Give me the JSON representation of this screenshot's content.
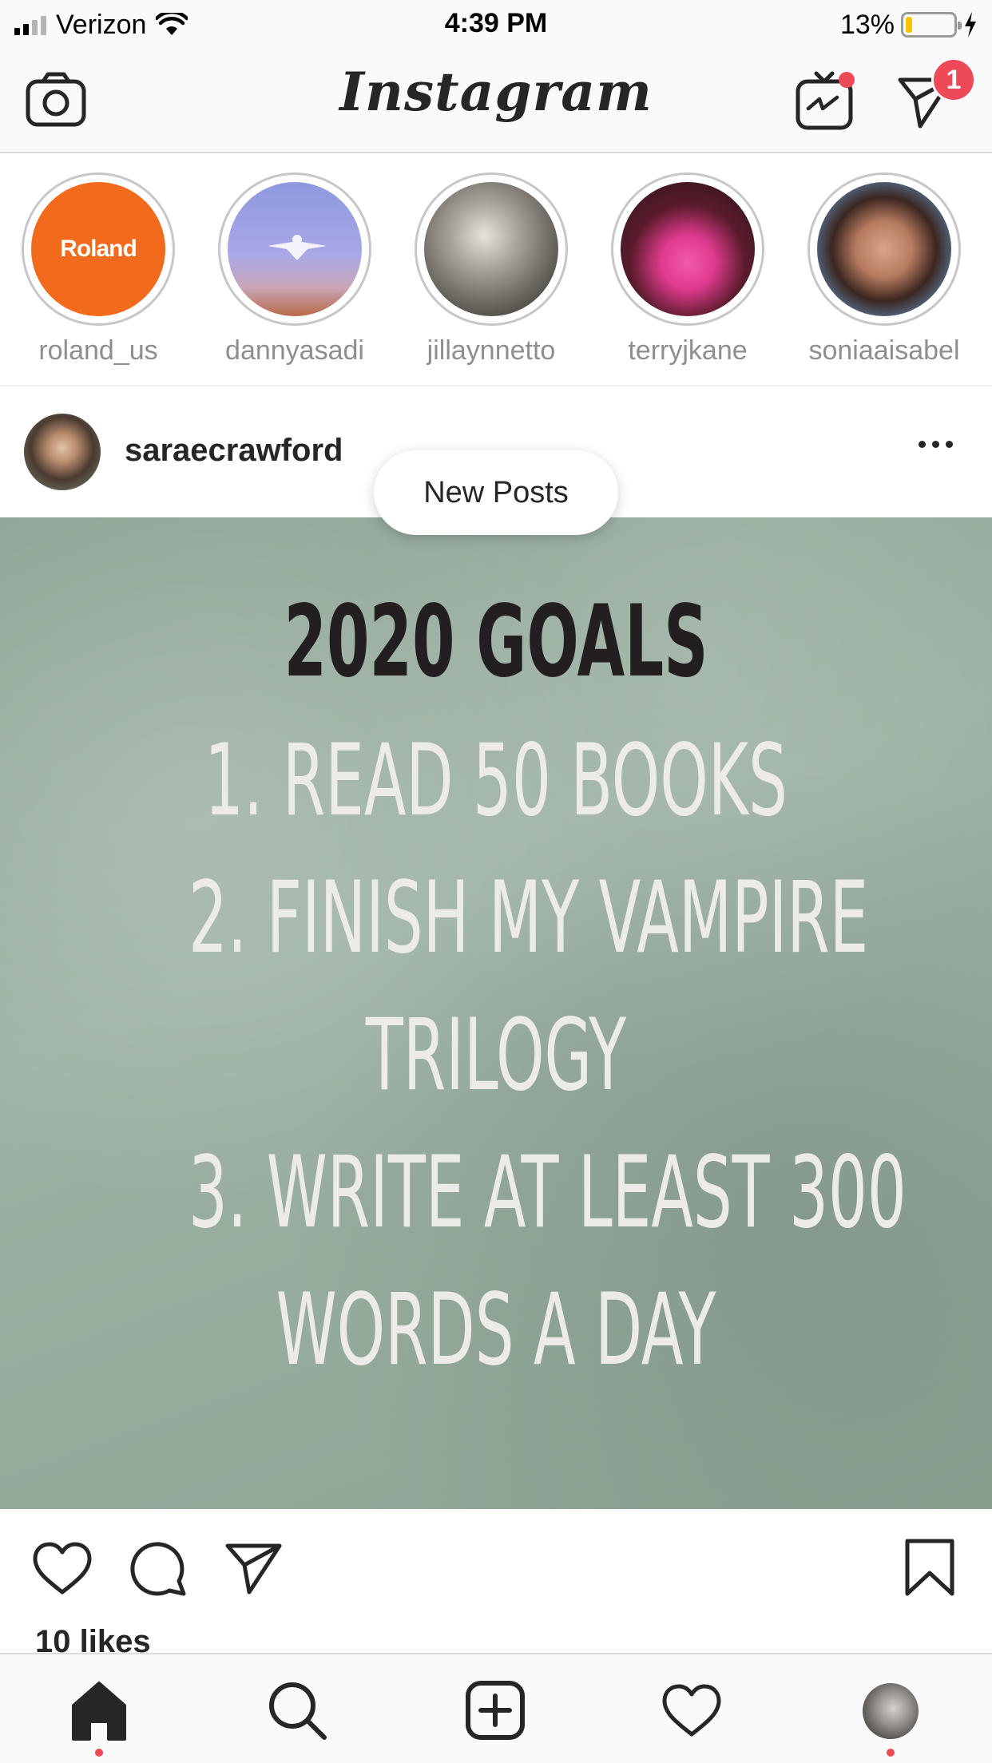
{
  "status_bar": {
    "carrier": "Verizon",
    "time": "4:39 PM",
    "battery_percent": "13%",
    "battery_level": 0.13,
    "battery_color": "#f7c600"
  },
  "header": {
    "logo": "Instagram",
    "igtv_icon": "igtv-icon",
    "igtv_has_new": true,
    "direct_icon": "paper-plane-icon",
    "direct_badge": "1",
    "badge_color": "#ed4956"
  },
  "stories": [
    {
      "username": "roland_us",
      "avatar_text": "Roland"
    },
    {
      "username": "dannyasadi"
    },
    {
      "username": "jillaynnetto"
    },
    {
      "username": "terryjkane"
    },
    {
      "username": "soniaaisabel"
    }
  ],
  "post": {
    "username": "saraecrawford",
    "new_posts_label": "New Posts",
    "image_text": {
      "title": "2020 GOALS",
      "lines": [
        "1. READ 50 BOOKS",
        "2. FINISH MY VAMPIRE",
        "TRILOGY",
        "3. WRITE AT LEAST 300",
        "WORDS A DAY"
      ]
    },
    "likes": "10 likes"
  },
  "bottom_nav": {
    "items": [
      "home-icon",
      "search-icon",
      "add-post-icon",
      "activity-heart-icon",
      "profile-avatar"
    ],
    "active": "home-icon"
  }
}
